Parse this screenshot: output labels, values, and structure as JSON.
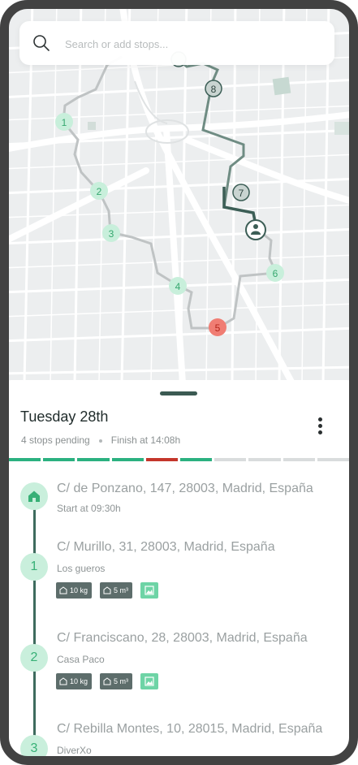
{
  "search": {
    "placeholder": "Search or add stops..."
  },
  "route": {
    "day": "Tuesday 28th",
    "pending": "4 stops pending",
    "finish": "Finish at 14:08h",
    "progress_colors": [
      "#2bb180",
      "#2bb180",
      "#2bb180",
      "#2bb180",
      "#c4362b",
      "#2bb180",
      "#d9dcdd",
      "#d9dcdd",
      "#d9dcdd",
      "#d9dcdd"
    ]
  },
  "map": {
    "markers": [
      {
        "label": "1",
        "status": "pending",
        "color": "#c8efdb"
      },
      {
        "label": "2",
        "status": "pending",
        "color": "#c8efdb"
      },
      {
        "label": "3",
        "status": "pending",
        "color": "#c8efdb"
      },
      {
        "label": "4",
        "status": "pending",
        "color": "#c8efdb"
      },
      {
        "label": "5",
        "status": "failed",
        "color": "#f07d73"
      },
      {
        "label": "6",
        "status": "pending",
        "color": "#c8efdb"
      },
      {
        "label": "7",
        "status": "done",
        "color": "#c9d4d1"
      },
      {
        "label": "8",
        "status": "done",
        "color": "#c9d4d1"
      }
    ],
    "driver_icon": "driver-icon"
  },
  "stops": [
    {
      "badge": "home-icon",
      "address": "C/ de Ponzano, 147, 28003, Madrid, España",
      "sub": "Start at 09:30h"
    },
    {
      "badge": "1",
      "address": "C/ Murillo, 31, 28003, Madrid, España",
      "sub": "Los gueros",
      "weight": "10 kg",
      "volume": "5 m³"
    },
    {
      "badge": "2",
      "address": "C/ Franciscano, 28, 28003, Madrid, España",
      "sub": "Casa Paco",
      "weight": "10 kg",
      "volume": "5 m³"
    },
    {
      "badge": "3",
      "address": "C/ Rebilla Montes, 10, 28015, Madrid, España",
      "sub": "DiverXo"
    }
  ]
}
